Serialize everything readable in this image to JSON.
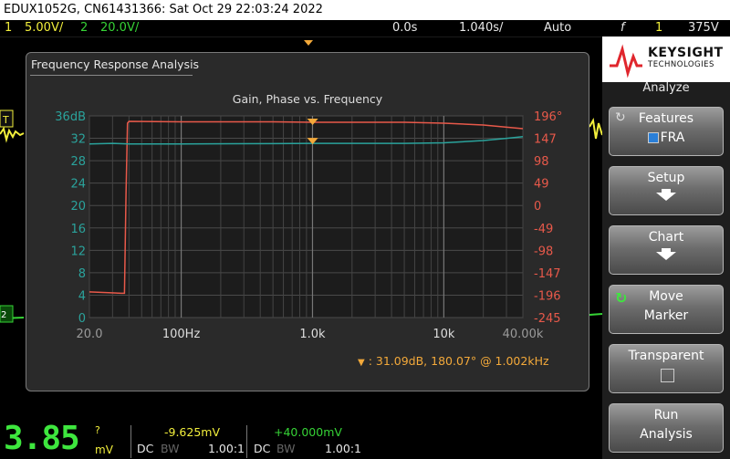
{
  "titlebar": {
    "text": "EDUX1052G, CN61431366: Sat Oct 29 22:03:24 2022"
  },
  "status": {
    "ch1_num": "1",
    "ch1_scale": "5.00V/",
    "ch2_num": "2",
    "ch2_scale": "20.0V/",
    "time_delay": "0.0s",
    "time_scale": "1.040s/",
    "trigger_mode": "Auto",
    "trigger_symbol": "f",
    "trigger_source": "1",
    "trigger_level": "375V"
  },
  "fra": {
    "window_title": "Frequency Response Analysis",
    "chart_title": "Gain, Phase vs. Frequency",
    "marker_readout": ":  31.09dB, 180.07° @ 1.002kHz",
    "marker_symbol": "▼"
  },
  "chart_data": {
    "type": "line",
    "title": "Gain, Phase vs. Frequency",
    "x_scale": "log",
    "xlim": [
      20,
      40000
    ],
    "x_tick_labels": [
      "20.0",
      "100Hz",
      "1.0k",
      "10k",
      "40.00k"
    ],
    "x_tick_values": [
      20,
      100,
      1000,
      10000,
      40000
    ],
    "y_left_label_unit": "dB",
    "y_left_ticks": [
      "36dB",
      "32",
      "28",
      "24",
      "20",
      "16",
      "12",
      "8",
      "4",
      "0"
    ],
    "ylim_left": [
      0,
      36
    ],
    "y_right_ticks": [
      "196°",
      "147",
      "98",
      "49",
      "0",
      "-49",
      "-98",
      "-147",
      "-196",
      "-245"
    ],
    "ylim_right": [
      -245,
      196
    ],
    "grid": true,
    "series": [
      {
        "color": "#e8594a",
        "axis": "right",
        "x": [
          20,
          35,
          37,
          38,
          39,
          40,
          100,
          500,
          1000,
          5000,
          10000,
          20000,
          40000
        ],
        "y": [
          -189,
          -192,
          -192,
          25,
          180,
          184,
          183,
          183,
          182,
          182,
          180,
          176,
          168
        ]
      },
      {
        "color": "#2aa39c",
        "axis": "left",
        "x": [
          20,
          30,
          40,
          100,
          500,
          1000,
          5000,
          10000,
          20000,
          30000,
          40000
        ],
        "y": [
          31.0,
          31.1,
          31.0,
          31.0,
          31.05,
          31.09,
          31.1,
          31.2,
          31.6,
          32.0,
          32.3
        ]
      }
    ],
    "marker": {
      "x": 1002,
      "gain_db": 31.09,
      "phase_deg": 180.07
    }
  },
  "panel": {
    "brand": "KEYSIGHT",
    "brand_sub": "TECHNOLOGIES",
    "heading": "Analyze",
    "buttons": [
      {
        "l1": "Features",
        "l2": "FRA"
      },
      {
        "l1": "Setup"
      },
      {
        "l1": "Chart"
      },
      {
        "l1": "Move",
        "l2": "Marker"
      },
      {
        "l1": "Transparent"
      },
      {
        "l1": "Run",
        "l2": "Analysis"
      }
    ]
  },
  "bottom": {
    "big_value": "3.85",
    "big_unit": "mV",
    "big_q": "?",
    "ch1_measure": "-9.625mV",
    "ch2_measure": "+40.000mV",
    "ch1_coupling": "DC",
    "ch1_bw": "BW",
    "ch1_probe": "1.00:1",
    "ch2_coupling": "DC",
    "ch2_bw": "BW",
    "ch2_probe": "1.00:1"
  },
  "colors": {
    "ch1": "#f2ef3c",
    "ch2": "#36d336",
    "gain": "#2aa39c",
    "phase": "#e8594a",
    "marker": "#f3a93a"
  }
}
